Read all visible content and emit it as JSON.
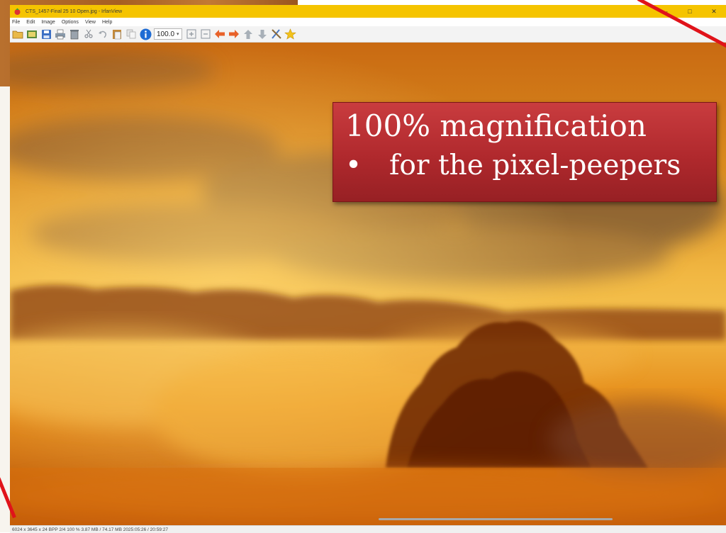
{
  "window": {
    "title": "CTS_1457-Final 25 10 Open.jpg - IrfanView",
    "controls": {
      "minimize": "–",
      "maximize": "□",
      "close": "✕"
    }
  },
  "menu": [
    "File",
    "Edit",
    "Image",
    "Options",
    "View",
    "Help"
  ],
  "toolbar": {
    "icons": [
      "open-folder-icon",
      "thumbnails-icon",
      "save-icon",
      "print-icon",
      "delete-icon",
      "cut-icon",
      "undo-icon",
      "paste-icon",
      "copy-icon",
      "info-icon"
    ],
    "zoom_value": "100.0",
    "zoom_dropdown": "▾",
    "nav_icons": [
      "zoom-in-icon",
      "zoom-out-icon",
      "previous-icon",
      "next-icon",
      "up-icon",
      "down-icon",
      "settings-icon",
      "favorite-icon"
    ]
  },
  "status": "6024 x 3645 x 24 BPP    2/4    100 %    3.87 MB / 74.17 MB    2025:05:26 / 20:59:27",
  "callout": {
    "heading": "100% magnification",
    "bullet": "•",
    "item": "for the pixel-peepers"
  },
  "colors": {
    "titlebar": "#f5c400",
    "callout": "#b0292d",
    "annotation_line": "#e0131a"
  }
}
